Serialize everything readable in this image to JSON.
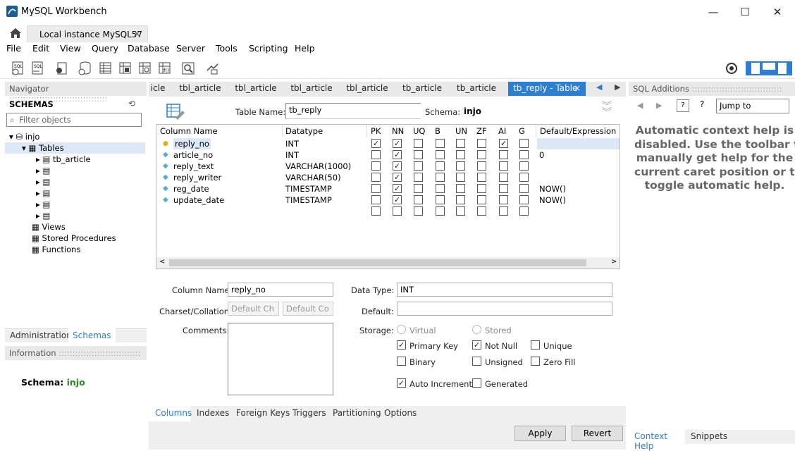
{
  "window": {
    "title": "MySQL Workbench",
    "minimize": "—",
    "maximize": "☐",
    "close": "✕"
  },
  "conn_tab": {
    "label": "Local instance MySQL57",
    "close": "×"
  },
  "menu": [
    "File",
    "Edit",
    "View",
    "Query",
    "Database",
    "Server",
    "Tools",
    "Scripting",
    "Help"
  ],
  "navigator": {
    "title": "Navigator",
    "schemas_label": "SCHEMAS",
    "filter_placeholder": "Filter objects",
    "schema": "injo",
    "tables_label": "Tables",
    "first_table": "tb_article",
    "views": "Views",
    "procedures": "Stored Procedures",
    "functions": "Functions",
    "tabs": [
      "Administration",
      "Schemas"
    ],
    "info_title": "Information",
    "info_schema_label": "Schema:",
    "info_schema_value": "injo"
  },
  "doc_tabs": [
    "icle",
    "tbl_article",
    "tbl_article",
    "tbl_article",
    "tbl_article",
    "tb_article",
    "tb_article"
  ],
  "active_tab": {
    "label": "tb_reply - Table",
    "close": "×"
  },
  "table_editor": {
    "table_name_label": "Table Name:",
    "table_name": "tb_reply",
    "schema_label": "Schema:",
    "schema": "injo",
    "headers": [
      "Column Name",
      "Datatype",
      "PK",
      "NN",
      "UQ",
      "B",
      "UN",
      "ZF",
      "AI",
      "G",
      "Default/Expression"
    ],
    "rows": [
      {
        "name": "reply_no",
        "type": "INT",
        "flags": [
          1,
          1,
          0,
          0,
          0,
          0,
          1,
          0
        ],
        "default": ""
      },
      {
        "name": "article_no",
        "type": "INT",
        "flags": [
          0,
          1,
          0,
          0,
          0,
          0,
          0,
          0
        ],
        "default": "0"
      },
      {
        "name": "reply_text",
        "type": "VARCHAR(1000)",
        "flags": [
          0,
          1,
          0,
          0,
          0,
          0,
          0,
          0
        ],
        "default": ""
      },
      {
        "name": "reply_writer",
        "type": "VARCHAR(50)",
        "flags": [
          0,
          1,
          0,
          0,
          0,
          0,
          0,
          0
        ],
        "default": ""
      },
      {
        "name": "reg_date",
        "type": "TIMESTAMP",
        "flags": [
          0,
          1,
          0,
          0,
          0,
          0,
          0,
          0
        ],
        "default": "NOW()"
      },
      {
        "name": "update_date",
        "type": "TIMESTAMP",
        "flags": [
          0,
          1,
          0,
          0,
          0,
          0,
          0,
          0
        ],
        "default": "NOW()"
      }
    ]
  },
  "details": {
    "column_name_label": "Column Name:",
    "column_name": "reply_no",
    "data_type_label": "Data Type:",
    "data_type": "INT",
    "charset_label": "Charset/Collation:",
    "charset": "Default Ch",
    "collation": "Default Co",
    "default_label": "Default:",
    "comments_label": "Comments:",
    "storage_label": "Storage:",
    "virtual": "Virtual",
    "stored": "Stored",
    "primary_key": "Primary Key",
    "not_null": "Not Null",
    "unique": "Unique",
    "binary": "Binary",
    "unsigned": "Unsigned",
    "zero_fill": "Zero Fill",
    "auto_increment": "Auto Increment",
    "generated": "Generated"
  },
  "bottom_tabs": [
    "Columns",
    "Indexes",
    "Foreign Keys",
    "Triggers",
    "Partitioning",
    "Options"
  ],
  "buttons": {
    "apply": "Apply",
    "revert": "Revert"
  },
  "sql_additions": {
    "title": "SQL Additions",
    "jump_to": "Jump to",
    "help_lines": [
      "Automatic context help is",
      "disabled. Use the toolbar t",
      "manually get help for the",
      "current caret position or to",
      "toggle automatic help."
    ],
    "tabs": [
      "Context Help",
      "Snippets"
    ]
  },
  "colors": {
    "accent": "#2d7dd2",
    "schema_green": "#2a8a2a"
  }
}
